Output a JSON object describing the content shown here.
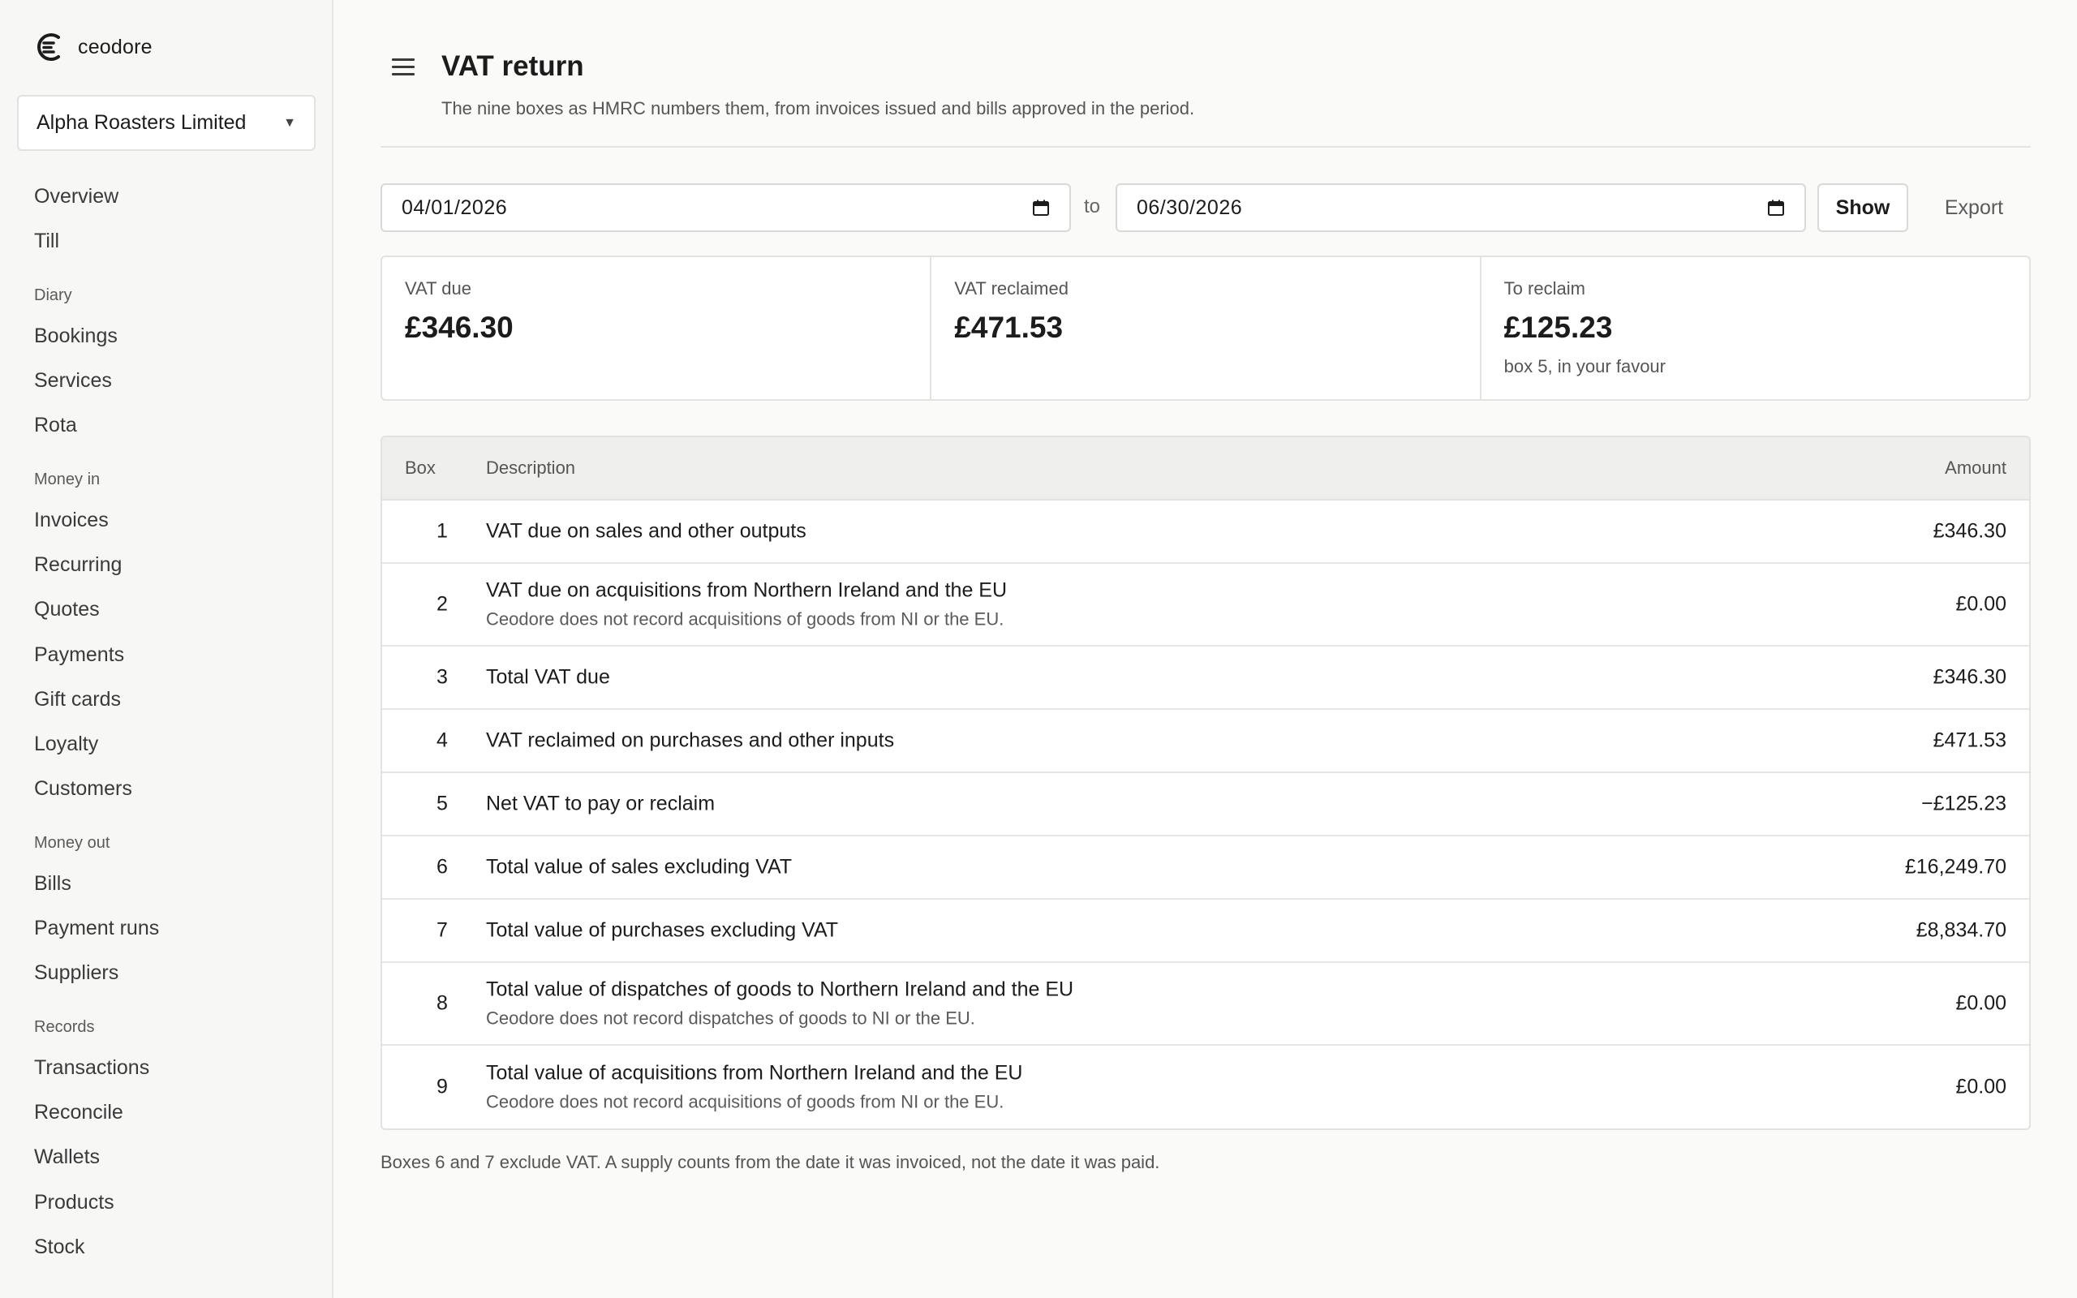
{
  "brand": {
    "name": "ceodore"
  },
  "org": {
    "name": "Alpha Roasters Limited",
    "caret": "▼"
  },
  "nav": {
    "overview": "Overview",
    "till": "Till",
    "diary_heading": "Diary",
    "bookings": "Bookings",
    "services": "Services",
    "rota": "Rota",
    "money_in_heading": "Money in",
    "invoices": "Invoices",
    "recurring": "Recurring",
    "quotes": "Quotes",
    "payments": "Payments",
    "gift_cards": "Gift cards",
    "loyalty": "Loyalty",
    "customers": "Customers",
    "money_out_heading": "Money out",
    "bills": "Bills",
    "payment_runs": "Payment runs",
    "suppliers": "Suppliers",
    "records_heading": "Records",
    "transactions": "Transactions",
    "reconcile": "Reconcile",
    "wallets": "Wallets",
    "products": "Products",
    "stock": "Stock"
  },
  "header": {
    "title": "VAT return",
    "subtitle": "The nine boxes as HMRC numbers them, from invoices issued and bills approved in the period."
  },
  "filters": {
    "from_date": "04/01/2026",
    "to_label": "to",
    "to_date": "06/30/2026",
    "show_label": "Show",
    "export_label": "Export"
  },
  "summary": {
    "vat_due_label": "VAT due",
    "vat_due_value": "£346.30",
    "vat_reclaimed_label": "VAT reclaimed",
    "vat_reclaimed_value": "£471.53",
    "to_reclaim_label": "To reclaim",
    "to_reclaim_value": "£125.23",
    "to_reclaim_note": "box 5, in your favour"
  },
  "table": {
    "headers": {
      "box": "Box",
      "description": "Description",
      "amount": "Amount"
    },
    "rows": [
      {
        "box": "1",
        "description": "VAT due on sales and other outputs",
        "note": "",
        "amount": "£346.30"
      },
      {
        "box": "2",
        "description": "VAT due on acquisitions from Northern Ireland and the EU",
        "note": "Ceodore does not record acquisitions of goods from NI or the EU.",
        "amount": "£0.00"
      },
      {
        "box": "3",
        "description": "Total VAT due",
        "note": "",
        "amount": "£346.30"
      },
      {
        "box": "4",
        "description": "VAT reclaimed on purchases and other inputs",
        "note": "",
        "amount": "£471.53"
      },
      {
        "box": "5",
        "description": "Net VAT to pay or reclaim",
        "note": "",
        "amount": "−£125.23"
      },
      {
        "box": "6",
        "description": "Total value of sales excluding VAT",
        "note": "",
        "amount": "£16,249.70"
      },
      {
        "box": "7",
        "description": "Total value of purchases excluding VAT",
        "note": "",
        "amount": "£8,834.70"
      },
      {
        "box": "8",
        "description": "Total value of dispatches of goods to Northern Ireland and the EU",
        "note": "Ceodore does not record dispatches of goods to NI or the EU.",
        "amount": "£0.00"
      },
      {
        "box": "9",
        "description": "Total value of acquisitions from Northern Ireland and the EU",
        "note": "Ceodore does not record acquisitions of goods from NI or the EU.",
        "amount": "£0.00"
      }
    ]
  },
  "footnote": "Boxes 6 and 7 exclude VAT. A supply counts from the date it was invoiced, not the date it was paid."
}
